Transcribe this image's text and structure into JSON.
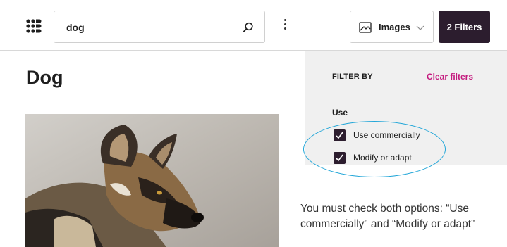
{
  "header": {
    "search": {
      "value": "dog"
    },
    "type_select": {
      "label": "Images"
    },
    "filters_button": {
      "label": "2 Filters"
    }
  },
  "main": {
    "title": "Dog"
  },
  "filter_panel": {
    "heading": "FILTER BY",
    "clear_label": "Clear filters",
    "group_label": "Use",
    "options": [
      {
        "label": "Use commercially",
        "checked": true
      },
      {
        "label": "Modify or adapt",
        "checked": true
      }
    ]
  },
  "note": {
    "line1": "You must check both options: “Use",
    "line2": "commercially” and “Modify or adapt”"
  },
  "colors": {
    "accent_dark": "#2c1d2e",
    "clear_link": "#c41a7e",
    "highlight": "#22a6d8",
    "panel_bg": "#f0f0f0"
  },
  "icons": [
    "logo-icon",
    "search-icon",
    "more-vertical-icon",
    "image-icon",
    "chevron-down-icon",
    "checkmark-icon"
  ]
}
